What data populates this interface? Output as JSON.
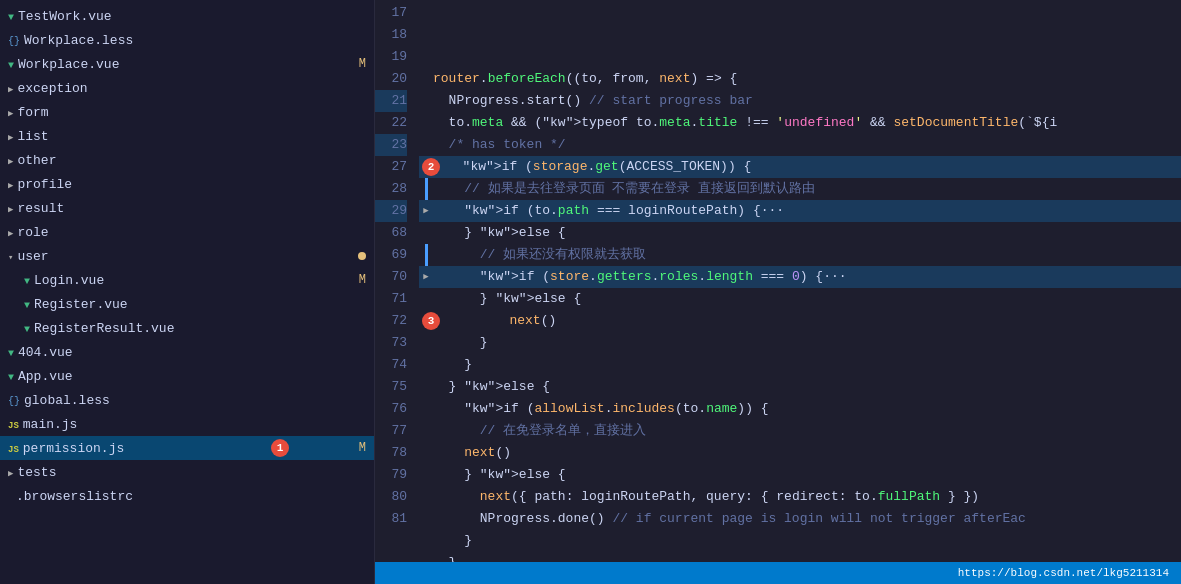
{
  "sidebar": {
    "items": [
      {
        "id": "testwork",
        "label": "TestWork.vue",
        "type": "vue",
        "indent": 0,
        "expanded": false,
        "badge": ""
      },
      {
        "id": "workplace-less",
        "label": "Workplace.less",
        "type": "less",
        "indent": 0,
        "expanded": false,
        "badge": ""
      },
      {
        "id": "workplace-vue",
        "label": "Workplace.vue",
        "type": "vue",
        "indent": 0,
        "expanded": false,
        "badge": "M"
      },
      {
        "id": "exception",
        "label": "exception",
        "type": "folder",
        "indent": 0,
        "expanded": false,
        "badge": ""
      },
      {
        "id": "form",
        "label": "form",
        "type": "folder",
        "indent": 0,
        "expanded": false,
        "badge": ""
      },
      {
        "id": "list",
        "label": "list",
        "type": "folder",
        "indent": 0,
        "expanded": false,
        "badge": ""
      },
      {
        "id": "other",
        "label": "other",
        "type": "folder",
        "indent": 0,
        "expanded": false,
        "badge": ""
      },
      {
        "id": "profile",
        "label": "profile",
        "type": "folder",
        "indent": 0,
        "expanded": false,
        "badge": ""
      },
      {
        "id": "result",
        "label": "result",
        "type": "folder",
        "indent": 0,
        "expanded": false,
        "badge": ""
      },
      {
        "id": "role",
        "label": "role",
        "type": "folder",
        "indent": 0,
        "expanded": false,
        "badge": ""
      },
      {
        "id": "user",
        "label": "user",
        "type": "folder-open",
        "indent": 0,
        "expanded": true,
        "badge": "",
        "dot": true
      },
      {
        "id": "login-vue",
        "label": "Login.vue",
        "type": "vue",
        "indent": 1,
        "expanded": false,
        "badge": "M"
      },
      {
        "id": "register-vue",
        "label": "Register.vue",
        "type": "vue",
        "indent": 1,
        "expanded": false,
        "badge": ""
      },
      {
        "id": "registerresult-vue",
        "label": "RegisterResult.vue",
        "type": "vue",
        "indent": 1,
        "expanded": false,
        "badge": ""
      },
      {
        "id": "404-vue",
        "label": "404.vue",
        "type": "vue",
        "indent": 0,
        "expanded": false,
        "badge": ""
      },
      {
        "id": "app-vue",
        "label": "App.vue",
        "type": "vue",
        "indent": 0,
        "expanded": false,
        "badge": ""
      },
      {
        "id": "global-less",
        "label": "global.less",
        "type": "less",
        "indent": 0,
        "expanded": false,
        "badge": ""
      },
      {
        "id": "main-js",
        "label": "main.js",
        "type": "js",
        "indent": 0,
        "expanded": false,
        "badge": ""
      },
      {
        "id": "permission-js",
        "label": "permission.js",
        "type": "js",
        "indent": 0,
        "expanded": false,
        "badge": "M",
        "active": true
      },
      {
        "id": "tests",
        "label": "tests",
        "type": "folder",
        "indent": 0,
        "expanded": false,
        "badge": ""
      },
      {
        "id": "browserslistrc",
        "label": ".browserslistrc",
        "type": "file",
        "indent": 0,
        "expanded": false,
        "badge": ""
      }
    ]
  },
  "code": {
    "lines": [
      {
        "num": 17,
        "content": "router.beforeEach((to, from, next) => {",
        "highlight": false,
        "gutter": ""
      },
      {
        "num": 18,
        "content": "  NProgress.start() // start progress bar",
        "highlight": false,
        "gutter": ""
      },
      {
        "num": 19,
        "content": "  to.meta && (typeof to.meta.title !== 'undefined' && setDocumentTitle(`${i",
        "highlight": false,
        "gutter": ""
      },
      {
        "num": 20,
        "content": "  /* has token */",
        "highlight": false,
        "gutter": ""
      },
      {
        "num": 21,
        "content": "  if (storage.get(ACCESS_TOKEN)) {",
        "highlight": true,
        "gutter": "",
        "annotation": "2"
      },
      {
        "num": 22,
        "content": "    // 如果是去往登录页面 不需要在登录 直接返回到默认路由",
        "highlight": false,
        "gutter": "bar"
      },
      {
        "num": 23,
        "content": "    if (to.path === loginRoutePath) {···",
        "highlight": true,
        "gutter": "arrow"
      },
      {
        "num": 27,
        "content": "    } else {",
        "highlight": false,
        "gutter": ""
      },
      {
        "num": 28,
        "content": "      // 如果还没有权限就去获取",
        "highlight": false,
        "gutter": "bar"
      },
      {
        "num": 29,
        "content": "      if (store.getters.roles.length === 0) {···",
        "highlight": true,
        "gutter": "arrow"
      },
      {
        "num": 68,
        "content": "      } else {",
        "highlight": false,
        "gutter": ""
      },
      {
        "num": 69,
        "content": "        next()",
        "highlight": false,
        "gutter": "",
        "annotation": "3"
      },
      {
        "num": 70,
        "content": "      }",
        "highlight": false,
        "gutter": ""
      },
      {
        "num": 71,
        "content": "    }",
        "highlight": false,
        "gutter": ""
      },
      {
        "num": 72,
        "content": "  } else {",
        "highlight": false,
        "gutter": ""
      },
      {
        "num": 73,
        "content": "    if (allowList.includes(to.name)) {",
        "highlight": false,
        "gutter": ""
      },
      {
        "num": 74,
        "content": "      // 在免登录名单，直接进入",
        "highlight": false,
        "gutter": ""
      },
      {
        "num": 75,
        "content": "    next()",
        "highlight": false,
        "gutter": ""
      },
      {
        "num": 76,
        "content": "    } else {",
        "highlight": false,
        "gutter": ""
      },
      {
        "num": 77,
        "content": "      next({ path: loginRoutePath, query: { redirect: to.fullPath } })",
        "highlight": false,
        "gutter": ""
      },
      {
        "num": 78,
        "content": "      NProgress.done() // if current page is login will not trigger afterEac",
        "highlight": false,
        "gutter": ""
      },
      {
        "num": 79,
        "content": "    }",
        "highlight": false,
        "gutter": ""
      },
      {
        "num": 80,
        "content": "  }",
        "highlight": false,
        "gutter": ""
      },
      {
        "num": 81,
        "content": "})",
        "highlight": false,
        "gutter": ""
      }
    ]
  },
  "statusbar": {
    "url": "https://blog.csdn.net/lkg5211314"
  },
  "annotations": {
    "badge1_label": "1",
    "badge2_label": "2",
    "badge3_label": "3"
  }
}
